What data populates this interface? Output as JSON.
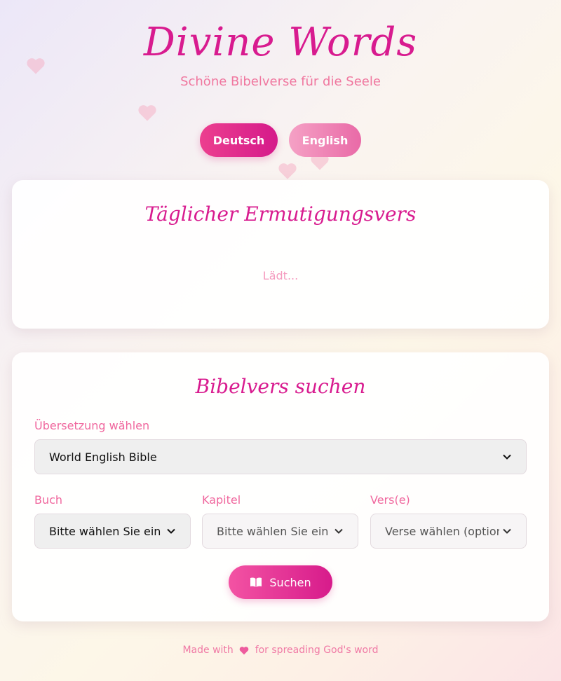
{
  "header": {
    "title": "Divine Words",
    "subtitle": "Schöne Bibelverse für die Seele"
  },
  "language": {
    "options": [
      "Deutsch",
      "English"
    ],
    "selected": "Deutsch"
  },
  "daily_verse": {
    "title": "Täglicher Ermutigungsvers",
    "status": "Lädt..."
  },
  "search": {
    "title": "Bibelvers suchen",
    "translation_label": "Übersetzung wählen",
    "translation_value": "World English Bible",
    "book_label": "Buch",
    "book_value": "Bitte wählen Sie ein Bu",
    "chapter_label": "Kapitel",
    "chapter_value": "Bitte wählen Sie ein Ka",
    "verse_label": "Vers(e)",
    "verse_value": "Verse wählen (optional",
    "button_label": "Suchen",
    "button_icon": "open-book-icon"
  },
  "footer": {
    "prefix": "Made with",
    "suffix": "for spreading God's word",
    "icon": "heart-icon"
  },
  "colors": {
    "accent": "#d81b8f",
    "label": "#f0679e",
    "button_gradient_start": "#f353a3"
  }
}
